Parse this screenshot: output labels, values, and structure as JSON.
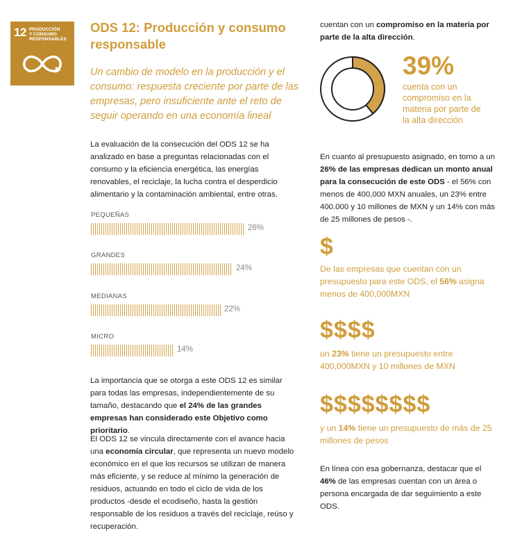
{
  "badge": {
    "number": "12",
    "label_line1": "PRODUCCIÓN",
    "label_line2": "Y CONSUMO",
    "label_line3": "RESPONSABLES"
  },
  "left": {
    "title": "ODS 12: Producción y consumo responsable",
    "subtitle": "Un cambio de modelo en la producción y el consumo: respuesta creciente por parte de las empresas, pero insuficiente ante el reto de seguir operando en una economía lineal",
    "p1": "La evaluación de la consecución del ODS 12 se ha analizado en base a preguntas relacionadas con el consumo y la eficiencia energética, las energías renovables, el reciclaje, la lucha contra el desperdicio alimentario y la contaminación ambiental, entre otras.",
    "p2_a": "La importancia que se otorga a este ODS 12 es similar para todas las empresas, independientemente de su tamaño, destacando que ",
    "p2_b": "el 24% de las grandes empresas han considerado este Objetivo como prioritario",
    "p2_c": ".",
    "p3_a": "El ODS 12 se vincula directamente con el avance hacia una ",
    "p3_b": "economía circular",
    "p3_c": ", que representa un nuevo modelo económico en el que los recursos se utilizan de manera más eficiente, y se reduce al mínimo la generación de residuos, actuando en todo el ciclo de vida de los productos -desde el ecodiseño, hasta la gestión responsable de los residuos a través del reciclaje, reúso y recuperación."
  },
  "chart_data": {
    "type": "bar",
    "categories": [
      "PEQUEÑAS",
      "GRANDES",
      "MEDIANAS",
      "MICRO"
    ],
    "values": [
      26,
      24,
      22,
      14
    ],
    "value_labels": [
      "26%",
      "24%",
      "22%",
      "14%"
    ]
  },
  "right": {
    "top_a": "cuentan con un ",
    "top_b": "compromiso en la materia por parte de la alta dirección",
    "top_c": ".",
    "donut_value": 39,
    "big_pct": "39%",
    "big_caption": "cuenta con un compromiso en la materia por parte de la alta dirección",
    "budget_a": "En cuanto al presupuesto asignado, en torno a un ",
    "budget_b": "26% de las empresas dedican un monto anual para la consecución de este ODS",
    "budget_c": " - el 56% con menos de 400,000 MXN anuales, un 23% entre 400.000 y 10 millones de MXN y un 14% con más de 25 millones de pesos -.",
    "dollar1": "$",
    "cap1_a": "De las empresas que cuentan con un presupuesto para este ODS, el ",
    "cap1_b": "56%",
    "cap1_c": " asigna menos de 400,000MXN",
    "dollar2": "$$$$",
    "cap2_a": "un ",
    "cap2_b": "23%",
    "cap2_c": " tiene un presupuesto entre 400,000MXN y 10 millones de MXN",
    "dollar3": "$$$$$$$$",
    "cap3_a": "y un ",
    "cap3_b": "14%",
    "cap3_c": " tiene un presupuesto de más de 25 millones de pesos",
    "bottom_a": "En línea con esa gobernanza, destacar que el ",
    "bottom_b": "46%",
    "bottom_c": " de las empresas cuentan con un área o persona encargada de dar seguimiento a este ODS."
  },
  "colors": {
    "accent": "#CF9D3B",
    "badge": "#BF8B2E"
  }
}
